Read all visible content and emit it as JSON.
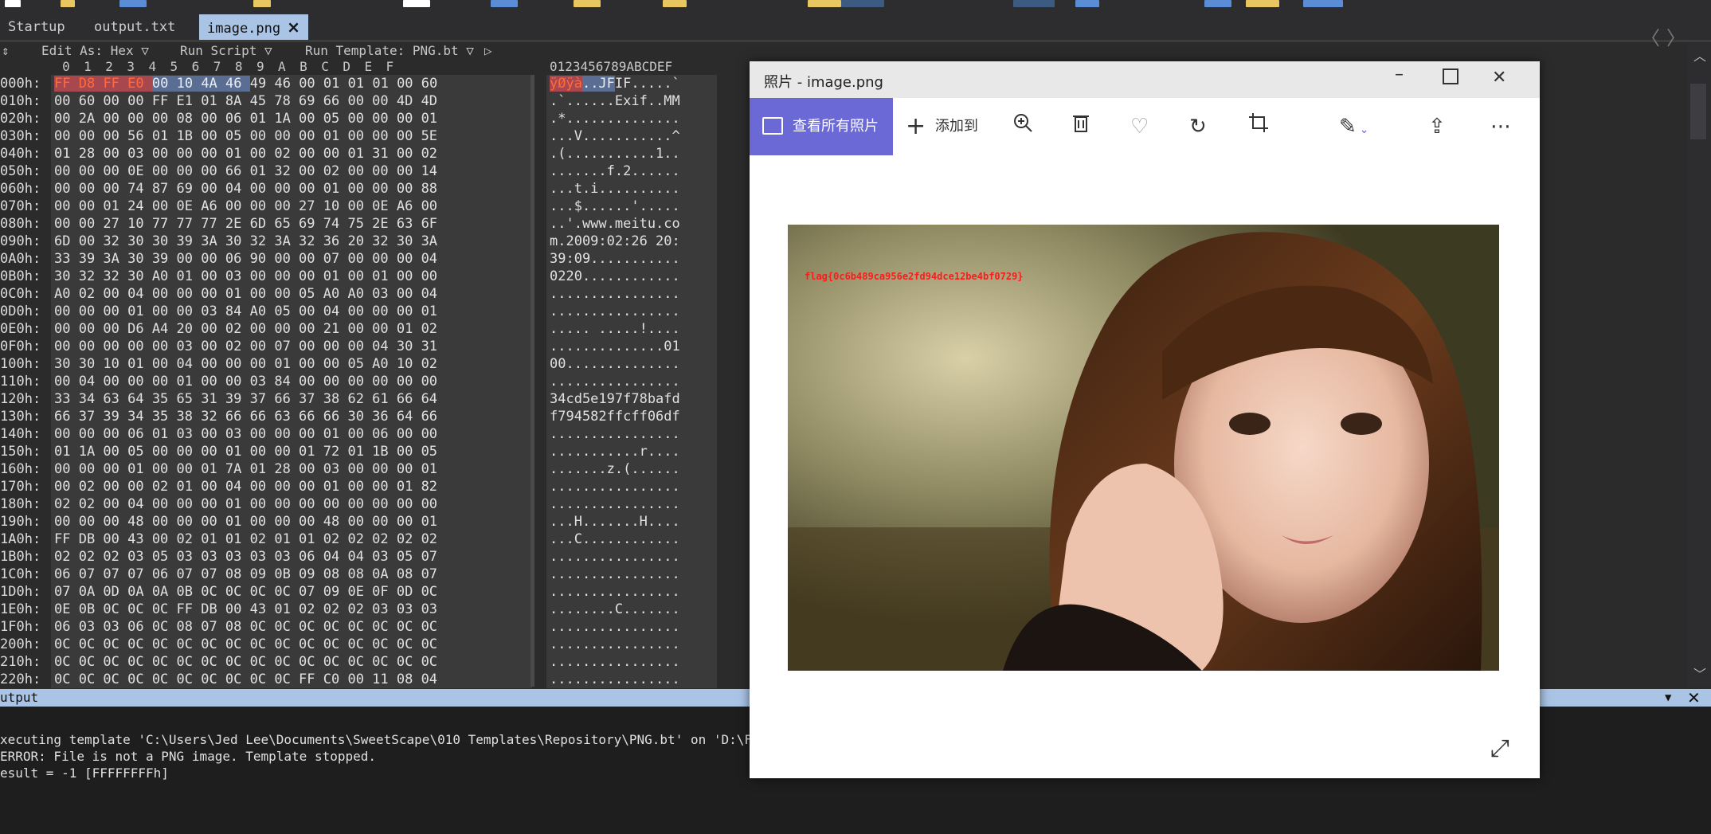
{
  "tabs": [
    {
      "label": "Startup",
      "active": false
    },
    {
      "label": "output.txt",
      "active": false
    },
    {
      "label": "image.png",
      "active": true,
      "close": "×"
    }
  ],
  "nav": {
    "back": "〈",
    "forward": "〉"
  },
  "hex_toolbar": {
    "edit_as": "Edit As: Hex ▽",
    "run_script": "Run Script ▽",
    "run_template": "Run Template: PNG.bt ▽"
  },
  "hex_header": {
    "columns": "  0  1  2  3  4  5  6  7  8  9  A  B  C  D  E  F",
    "ascii_columns": "0123456789ABCDEF"
  },
  "hex_rows": [
    {
      "addr": "000h:",
      "bytes": "FF D8 FF E0 00 10 4A 46 49 46 00 01 01 01 00 60",
      "ascii": "ÿØÿà..JFIF.....`"
    },
    {
      "addr": "010h:",
      "bytes": "00 60 00 00 FF E1 01 8A 45 78 69 66 00 00 4D 4D",
      "ascii": ".`......Exif..MM"
    },
    {
      "addr": "020h:",
      "bytes": "00 2A 00 00 00 08 00 06 01 1A 00 05 00 00 00 01",
      "ascii": ".*.............."
    },
    {
      "addr": "030h:",
      "bytes": "00 00 00 56 01 1B 00 05 00 00 00 01 00 00 00 5E",
      "ascii": "...V...........^"
    },
    {
      "addr": "040h:",
      "bytes": "01 28 00 03 00 00 00 01 00 02 00 00 01 31 00 02",
      "ascii": ".(...........1.."
    },
    {
      "addr": "050h:",
      "bytes": "00 00 00 0E 00 00 00 66 01 32 00 02 00 00 00 14",
      "ascii": ".......f.2......"
    },
    {
      "addr": "060h:",
      "bytes": "00 00 00 74 87 69 00 04 00 00 00 01 00 00 00 88",
      "ascii": "...t.i.........."
    },
    {
      "addr": "070h:",
      "bytes": "00 00 01 24 00 0E A6 00 00 00 27 10 00 0E A6 00",
      "ascii": "...$......'....."
    },
    {
      "addr": "080h:",
      "bytes": "00 00 27 10 77 77 77 2E 6D 65 69 74 75 2E 63 6F",
      "ascii": "..'.www.meitu.co"
    },
    {
      "addr": "090h:",
      "bytes": "6D 00 32 30 30 39 3A 30 32 3A 32 36 20 32 30 3A",
      "ascii": "m.2009:02:26 20:"
    },
    {
      "addr": "0A0h:",
      "bytes": "33 39 3A 30 39 00 00 06 90 00 00 07 00 00 00 04",
      "ascii": "39:09..........."
    },
    {
      "addr": "0B0h:",
      "bytes": "30 32 32 30 A0 01 00 03 00 00 00 01 00 01 00 00",
      "ascii": "0220............"
    },
    {
      "addr": "0C0h:",
      "bytes": "A0 02 00 04 00 00 00 01 00 00 05 A0 A0 03 00 04",
      "ascii": "................"
    },
    {
      "addr": "0D0h:",
      "bytes": "00 00 00 01 00 00 03 84 A0 05 00 04 00 00 00 01",
      "ascii": "................"
    },
    {
      "addr": "0E0h:",
      "bytes": "00 00 00 D6 A4 20 00 02 00 00 00 21 00 00 01 02",
      "ascii": "..... .....!...."
    },
    {
      "addr": "0F0h:",
      "bytes": "00 00 00 00 00 03 00 02 00 07 00 00 00 04 30 31",
      "ascii": "..............01"
    },
    {
      "addr": "100h:",
      "bytes": "30 30 10 01 00 04 00 00 00 01 00 00 05 A0 10 02",
      "ascii": "00.............."
    },
    {
      "addr": "110h:",
      "bytes": "00 04 00 00 00 01 00 00 03 84 00 00 00 00 00 00",
      "ascii": "................"
    },
    {
      "addr": "120h:",
      "bytes": "33 34 63 64 35 65 31 39 37 66 37 38 62 61 66 64",
      "ascii": "34cd5e197f78bafd"
    },
    {
      "addr": "130h:",
      "bytes": "66 37 39 34 35 38 32 66 66 63 66 66 30 36 64 66",
      "ascii": "f794582ffcff06df"
    },
    {
      "addr": "140h:",
      "bytes": "00 00 00 06 01 03 00 03 00 00 00 01 00 06 00 00",
      "ascii": "................"
    },
    {
      "addr": "150h:",
      "bytes": "01 1A 00 05 00 00 00 01 00 00 01 72 01 1B 00 05",
      "ascii": "...........r...."
    },
    {
      "addr": "160h:",
      "bytes": "00 00 00 01 00 00 01 7A 01 28 00 03 00 00 00 01",
      "ascii": ".......z.(......"
    },
    {
      "addr": "170h:",
      "bytes": "00 02 00 00 02 01 00 04 00 00 00 01 00 00 01 82",
      "ascii": "................"
    },
    {
      "addr": "180h:",
      "bytes": "02 02 00 04 00 00 00 01 00 00 00 00 00 00 00 00",
      "ascii": "................"
    },
    {
      "addr": "190h:",
      "bytes": "00 00 00 48 00 00 00 01 00 00 00 48 00 00 00 01",
      "ascii": "...H.......H...."
    },
    {
      "addr": "1A0h:",
      "bytes": "FF DB 00 43 00 02 01 01 02 01 01 02 02 02 02 02",
      "ascii": "...C............"
    },
    {
      "addr": "1B0h:",
      "bytes": "02 02 02 03 05 03 03 03 03 03 06 04 04 03 05 07",
      "ascii": "................"
    },
    {
      "addr": "1C0h:",
      "bytes": "06 07 07 07 06 07 07 08 09 0B 09 08 08 0A 08 07",
      "ascii": "................"
    },
    {
      "addr": "1D0h:",
      "bytes": "07 0A 0D 0A 0A 0B 0C 0C 0C 0C 07 09 0E 0F 0D 0C",
      "ascii": "................"
    },
    {
      "addr": "1E0h:",
      "bytes": "0E 0B 0C 0C 0C FF DB 00 43 01 02 02 02 03 03 03",
      "ascii": "........C......."
    },
    {
      "addr": "1F0h:",
      "bytes": "06 03 03 06 0C 08 07 08 0C 0C 0C 0C 0C 0C 0C 0C",
      "ascii": "................"
    },
    {
      "addr": "200h:",
      "bytes": "0C 0C 0C 0C 0C 0C 0C 0C 0C 0C 0C 0C 0C 0C 0C 0C",
      "ascii": "................"
    },
    {
      "addr": "210h:",
      "bytes": "0C 0C 0C 0C 0C 0C 0C 0C 0C 0C 0C 0C 0C 0C 0C 0C",
      "ascii": "................"
    },
    {
      "addr": "220h:",
      "bytes": "0C 0C 0C 0C 0C 0C 0C 0C 0C 0C FF C0 00 11 08 04",
      "ascii": "................"
    }
  ],
  "output": {
    "label": "utput",
    "lines": [
      "xecuting template 'C:\\Users\\Jed Lee\\Documents\\SweetScape\\010 Templates\\Repository\\PNG.bt' on 'D:\\F",
      "ERROR: File is not a PNG image. Template stopped.",
      "esult = -1 [FFFFFFFFh]"
    ]
  },
  "photos": {
    "title": "照片 - image.png",
    "view_all": "查看所有照片",
    "add_to": "添加到",
    "flag_text": "flag{0c6b489ca956e2fd94dce12be4bf0729}",
    "icons": [
      "zoom-in-icon",
      "delete-icon",
      "heart-icon",
      "rotate-icon",
      "crop-icon",
      "edit-icon",
      "share-icon",
      "more-icon"
    ]
  },
  "colors": {
    "accent": "#6b69d6",
    "tab_active": "#aac4e6",
    "editor_bg": "#2b2b2b",
    "highlight_red": "#a9474f",
    "highlight_blue": "#5a6e93"
  }
}
